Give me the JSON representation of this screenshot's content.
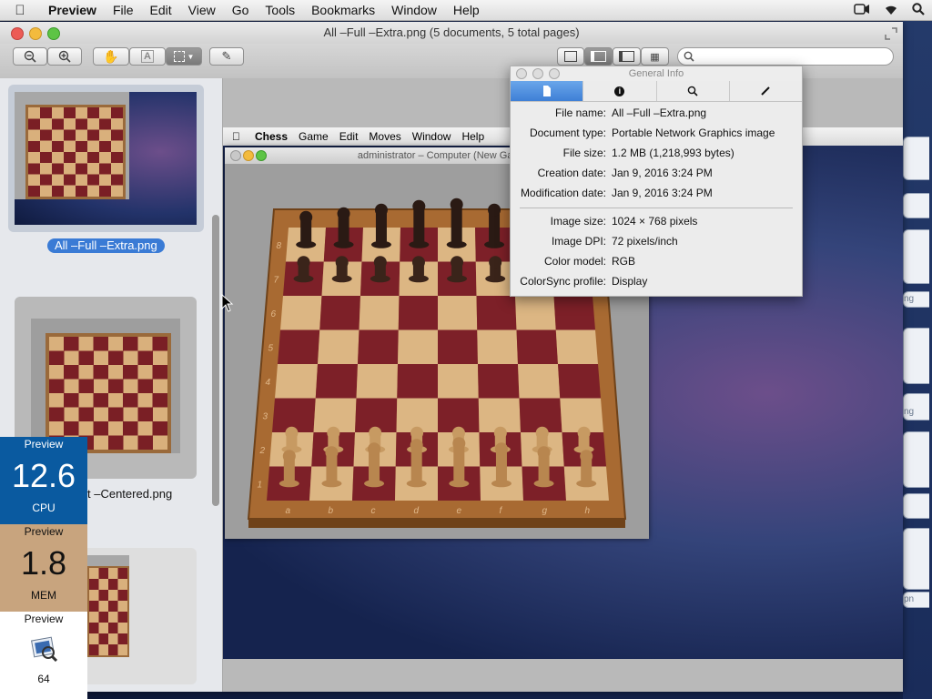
{
  "menubar": {
    "app": "Preview",
    "items": [
      "File",
      "Edit",
      "View",
      "Go",
      "Tools",
      "Bookmarks",
      "Window",
      "Help"
    ]
  },
  "window": {
    "title": "All –Full –Extra.png (5 documents, 5 total pages)"
  },
  "search": {
    "placeholder": ""
  },
  "sidebar": {
    "items": [
      {
        "label": "All –Full –Extra.png",
        "selected": true
      },
      {
        "label": "t –Centered.png",
        "selected": false
      },
      {
        "label": "",
        "selected": false
      }
    ]
  },
  "document": {
    "menubar": {
      "app": "Chess",
      "items": [
        "Game",
        "Edit",
        "Moves",
        "Window",
        "Help"
      ]
    },
    "chess_window_title": "administrator  – Computer  (New Gar",
    "rank_labels": [
      "8",
      "7",
      "6",
      "5",
      "4",
      "3",
      "2",
      "1"
    ],
    "file_labels": [
      "a",
      "b",
      "c",
      "d",
      "e",
      "f",
      "g",
      "h"
    ]
  },
  "info_panel": {
    "title": "General Info",
    "tabs": [
      "document-icon",
      "info-icon",
      "search-icon",
      "pen-icon"
    ],
    "rows1": [
      {
        "key": "File name:",
        "value": "All –Full –Extra.png"
      },
      {
        "key": "Document type:",
        "value": "Portable Network Graphics image"
      },
      {
        "key": "File size:",
        "value": "1.2 MB (1,218,993 bytes)"
      },
      {
        "key": "Creation date:",
        "value": "Jan 9, 2016 3:24 PM"
      },
      {
        "key": "Modification date:",
        "value": "Jan 9, 2016 3:24 PM"
      }
    ],
    "rows2": [
      {
        "key": "Image size:",
        "value": "1024 × 768 pixels"
      },
      {
        "key": "Image DPI:",
        "value": "72 pixels/inch"
      },
      {
        "key": "Color model:",
        "value": "RGB"
      },
      {
        "key": "ColorSync profile:",
        "value": "Display"
      }
    ]
  },
  "monitors": {
    "cpu": {
      "app": "Preview",
      "value": "12.6",
      "label": "CPU",
      "color": "#0a5aa0"
    },
    "mem": {
      "app": "Preview",
      "value": "1.8",
      "label": "MEM",
      "color": "#c8a47e"
    },
    "other": {
      "app": "Preview",
      "value": "64"
    }
  },
  "dock_tabs": [
    "ng",
    "ng",
    "pn"
  ]
}
